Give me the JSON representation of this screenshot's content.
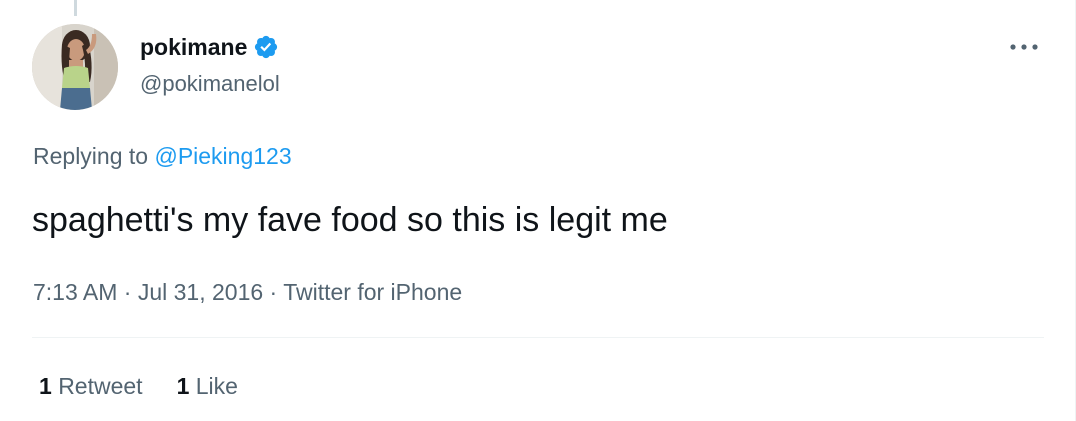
{
  "author": {
    "display_name": "pokimane",
    "handle": "@pokimanelol",
    "verified": true
  },
  "reply": {
    "prefix": "Replying to ",
    "mention": "@Pieking123"
  },
  "tweet": {
    "text": "spaghetti's my fave food so this is legit me"
  },
  "meta": {
    "time": "7:13 AM",
    "separator": " · ",
    "date": "Jul 31, 2016",
    "source": "Twitter for iPhone"
  },
  "stats": {
    "retweets_count": "1",
    "retweets_label": "Retweet",
    "likes_count": "1",
    "likes_label": "Like"
  },
  "icons": {
    "verified": "verified-badge-icon",
    "more": "more-dots-icon"
  },
  "colors": {
    "accent": "#1d9bf0",
    "text_primary": "#0f1419",
    "text_secondary": "#536471",
    "divider": "#eff3f4"
  }
}
